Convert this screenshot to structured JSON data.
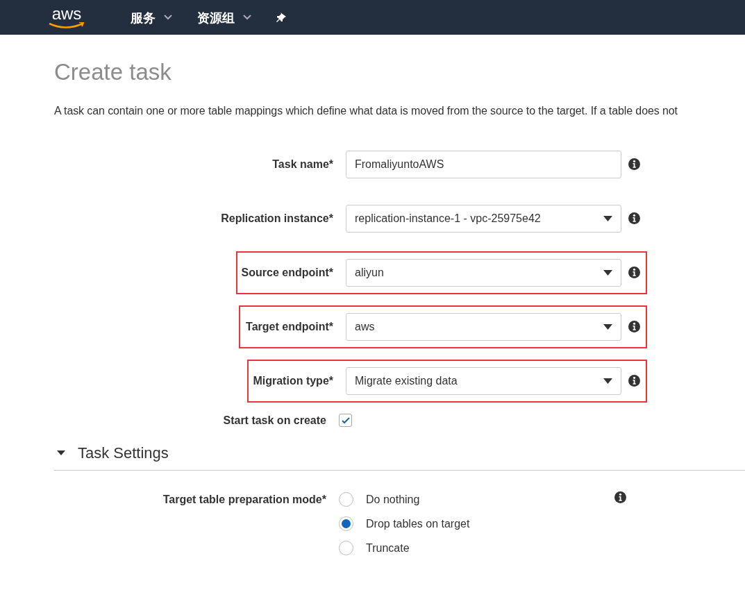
{
  "navbar": {
    "logo": "aws",
    "menus": [
      {
        "label": "服务"
      },
      {
        "label": "资源组"
      }
    ]
  },
  "title": "Create task",
  "description": "A task can contain one or more table mappings which define what data is moved from the source to the target. If a table does not",
  "fields": [
    {
      "kind": "text",
      "label": "Task name*",
      "value": "FromaliyuntoAWS",
      "highlighted": false
    },
    {
      "kind": "select",
      "label": "Replication instance*",
      "value": "replication-instance-1 - vpc-25975e42",
      "highlighted": false
    },
    {
      "kind": "select",
      "label": "Source endpoint*",
      "value": "aliyun",
      "highlighted": true
    },
    {
      "kind": "select",
      "label": "Target endpoint*",
      "value": "aws",
      "highlighted": true
    },
    {
      "kind": "select",
      "label": "Migration type*",
      "value": "Migrate existing data",
      "highlighted": true
    }
  ],
  "start_task": {
    "label": "Start task on create",
    "checked": true
  },
  "section": {
    "title": "Task Settings",
    "expanded": true
  },
  "prep_mode": {
    "label": "Target table preparation mode*",
    "options": [
      {
        "label": "Do nothing",
        "selected": false
      },
      {
        "label": "Drop tables on target",
        "selected": true
      },
      {
        "label": "Truncate",
        "selected": false
      }
    ]
  }
}
